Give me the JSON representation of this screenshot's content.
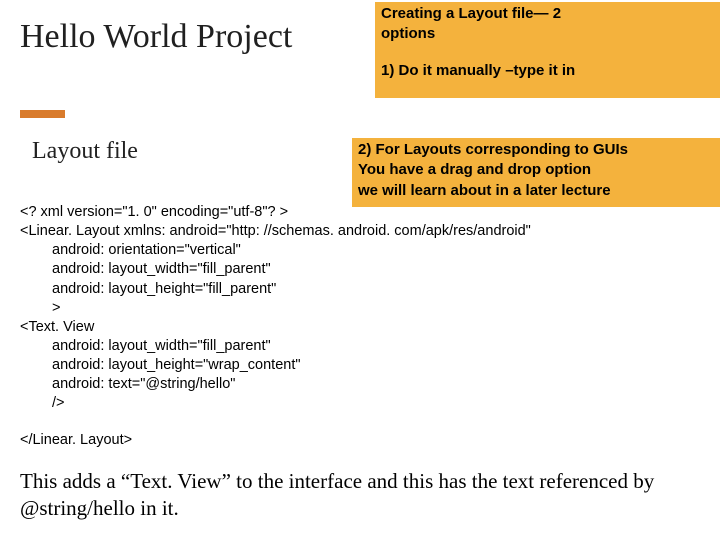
{
  "title": "Hello World Project",
  "subtitle": "Layout file",
  "callout_top": {
    "line1": "Creating a Layout file— 2",
    "line2": "options",
    "line3": "1) Do it manually –type it in"
  },
  "callout_mid": {
    "line1": "2) For Layouts corresponding to GUIs",
    "line2": "You have a drag and drop option",
    "line3": "we will learn about in a later lecture"
  },
  "code": {
    "l1": "<? xml version=\"1. 0\" encoding=\"utf-8\"? >",
    "l2": "<Linear. Layout xmlns: android=\"http: //schemas. android. com/apk/res/android\"",
    "l3": "android: orientation=\"vertical\"",
    "l4": "android: layout_width=\"fill_parent\"",
    "l5": "android: layout_height=\"fill_parent\"",
    "l6": ">",
    "l7": "<Text. View",
    "l8": "android: layout_width=\"fill_parent\"",
    "l9": "android: layout_height=\"wrap_content\"",
    "l10": "android: text=\"@string/hello\"",
    "l11": "/>",
    "l12": "</Linear. Layout>"
  },
  "body_text": "This adds a “Text. View” to the interface and this has the text referenced by @string/hello in it."
}
